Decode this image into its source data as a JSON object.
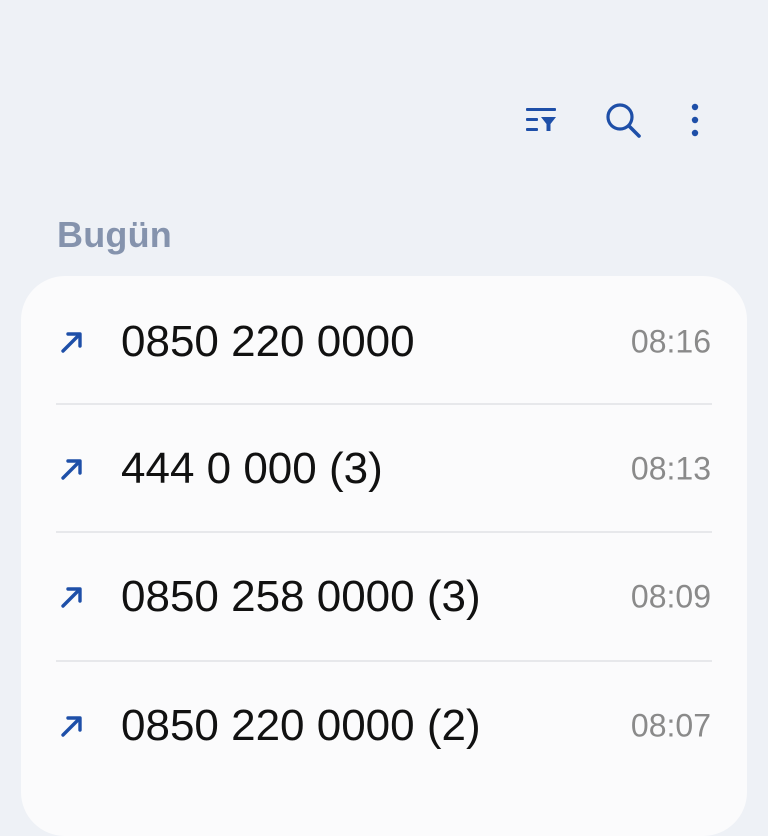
{
  "colors": {
    "background": "#eef1f6",
    "card": "#fbfbfc",
    "accent": "#1e4fa8",
    "section_title": "#8593ad",
    "number_text": "#111111",
    "time_text": "#8a8a8a"
  },
  "toolbar": {
    "icons": [
      "filter-icon",
      "search-icon",
      "more-vertical-icon"
    ]
  },
  "section": {
    "title": "Bugün"
  },
  "calls": [
    {
      "number": "0850 220 0000",
      "time": "08:16",
      "direction_icon": "outgoing-call-icon"
    },
    {
      "number": "444 0 000 (3)",
      "time": "08:13",
      "direction_icon": "outgoing-call-icon"
    },
    {
      "number": "0850 258 0000 (3)",
      "time": "08:09",
      "direction_icon": "outgoing-call-icon"
    },
    {
      "number": "0850 220 0000 (2)",
      "time": "08:07",
      "direction_icon": "outgoing-call-icon"
    }
  ]
}
